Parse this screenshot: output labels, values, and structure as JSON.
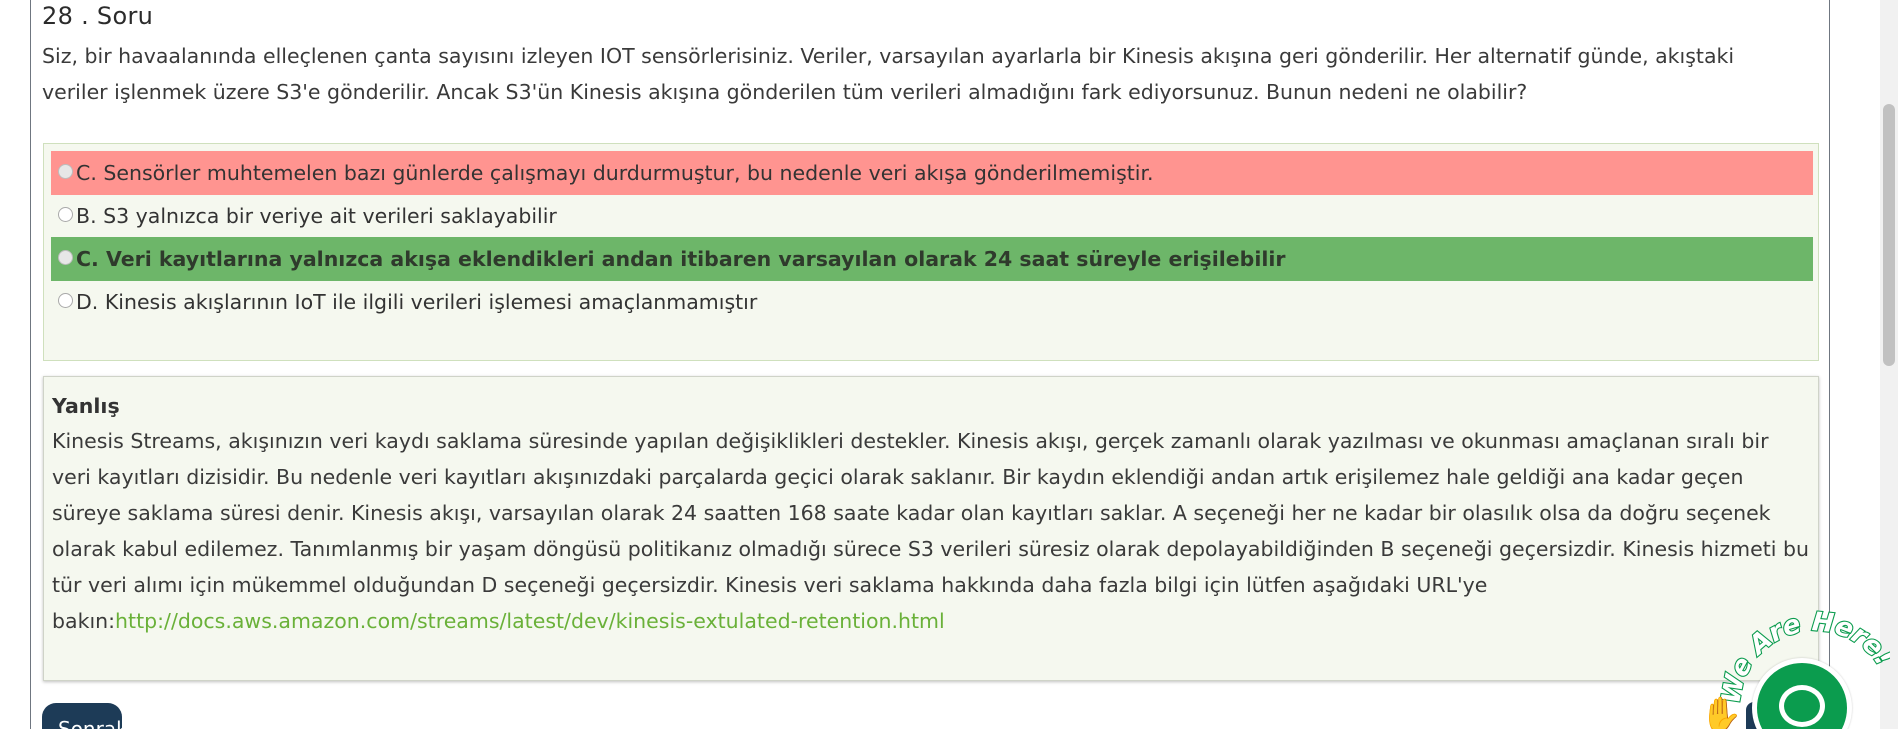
{
  "question": {
    "title": "28 . Soru",
    "text": "Siz, bir havaalanında elleçlenen çanta sayısını izleyen IOT sensörlerisiniz. Veriler, varsayılan ayarlarla bir Kinesis akışına geri gönderilir. Her alternatif günde, akıştaki veriler işlenmek üzere S3'e gönderilir. Ancak S3'ün Kinesis akışına gönderilen tüm verileri almadığını fark ediyorsunuz. Bunun nedeni ne olabilir?"
  },
  "options": [
    {
      "label": "C. Sensörler muhtemelen bazı günlerde çalışmayı durdurmuştur, bu nedenle veri akışa gönderilmemiştir.",
      "state": "wrong"
    },
    {
      "label": "B. S3 yalnızca bir veriye ait verileri saklayabilir",
      "state": "none"
    },
    {
      "label": "C. Veri kayıtlarına yalnızca akışa eklendikleri andan itibaren varsayılan olarak 24 saat süreyle erişilebilir",
      "state": "correct"
    },
    {
      "label": "D. Kinesis akışlarının IoT ile ilgili verileri işlemesi amaçlanmamıştır",
      "state": "none"
    }
  ],
  "explanation": {
    "title": "Yanlış",
    "text": "Kinesis Streams, akışınızın veri kaydı saklama süresinde yapılan değişiklikleri destekler. Kinesis akışı, gerçek zamanlı olarak yazılması ve okunması amaçlanan sıralı bir veri kayıtları dizisidir. Bu nedenle veri kayıtları akışınızdaki parçalarda geçici olarak saklanır. Bir kaydın eklendiği andan artık erişilemez hale geldiği ana kadar geçen süreye saklama süresi denir. Kinesis akışı, varsayılan olarak 24 saatten 168 saate kadar olan kayıtları saklar. A seçeneği her ne kadar bir olasılık olsa da doğru seçenek olarak kabul edilemez. Tanımlanmış bir yaşam döngüsü politikanız olmadığı sürece S3 verileri süresiz olarak depolayabildiğinden B seçeneği geçersizdir. Kinesis hizmeti bu tür veri alımı için mükemmel olduğundan D seçeneği geçersizdir. Kinesis veri saklama hakkında daha fazla bilgi için lütfen aşağıdaki URL'ye bakın:",
    "link": "http://docs.aws.amazon.com/streams/latest/dev/kinesis-extulated-retention.html"
  },
  "next_button": {
    "label": "Sonraki"
  },
  "chat_widget": {
    "badge_text": "We Are Here!",
    "icon": "chat-bubble-icon",
    "hand_icon": "waving-hand-icon"
  },
  "colors": {
    "wrong": "#ff9490",
    "correct": "#6db669",
    "link": "#6ab139",
    "chat": "#0b9c4e"
  }
}
